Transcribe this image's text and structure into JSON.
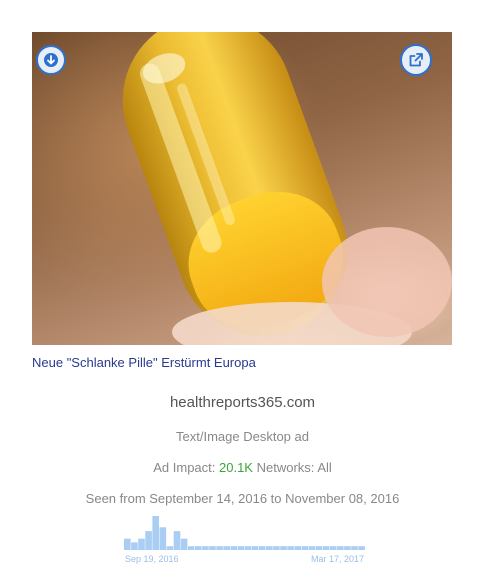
{
  "ad": {
    "headline": "Neue \"Schlanke Pille\" Erstürmt Europa",
    "domain": "healthreports365.com",
    "ad_type": "Text/Image Desktop ad",
    "impact_label": "Ad Impact:",
    "impact_value": "20.1K",
    "networks_label": "Networks:",
    "networks_value": "All",
    "seen_text": "Seen from September 14, 2016 to November 08, 2016"
  },
  "image": {
    "download_icon": "download-arrow-icon",
    "external_icon": "external-link-icon",
    "accent_color": "#2f6fcf"
  },
  "chart_data": {
    "type": "bar",
    "values": [
      3,
      2,
      3,
      5,
      9,
      6,
      1,
      5,
      3,
      1,
      1,
      1,
      1,
      1,
      1,
      1,
      1,
      1,
      1,
      1,
      1,
      1,
      1,
      1,
      1,
      1,
      1,
      1,
      1,
      1,
      1,
      1,
      1,
      1
    ],
    "x_start_label": "Sep 19, 2016",
    "x_end_label": "Mar 17, 2017",
    "color": "#a9cdf3"
  }
}
